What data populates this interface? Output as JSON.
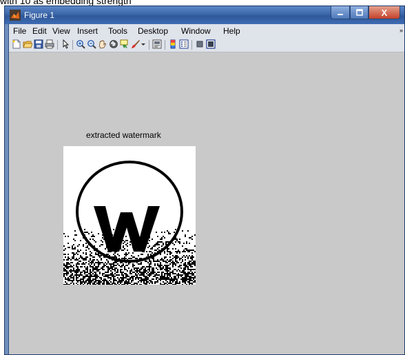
{
  "caption": {
    "text": "with 10 as embedding strength"
  },
  "window": {
    "title": "Figure 1",
    "close_label": "X",
    "minimize_label": "–",
    "maximize_label": "□"
  },
  "menu": {
    "items": [
      "File",
      "Edit",
      "View",
      "Insert",
      "Tools",
      "Desktop",
      "Window",
      "Help"
    ],
    "overflow_arrow": "»"
  },
  "toolbar": {
    "icons": [
      "new-figure-icon",
      "open-file-icon",
      "save-icon",
      "print-icon",
      "pointer-icon",
      "zoom-in-icon",
      "zoom-out-icon",
      "pan-icon",
      "rotate-3d-icon",
      "data-cursor-icon",
      "brush-icon",
      "link-plot-icon",
      "colorbar-icon",
      "legend-icon",
      "hide-plot-tools-icon",
      "show-plot-tools-icon"
    ]
  },
  "axes": {
    "title": "extracted watermark",
    "image_content": "binary watermark: circled W with noise"
  },
  "colors": {
    "titlebar": "#3b66a8",
    "figure_background": "#c9c9c9",
    "menubar": "#dfe3ea",
    "close_button": "#c4422b"
  }
}
